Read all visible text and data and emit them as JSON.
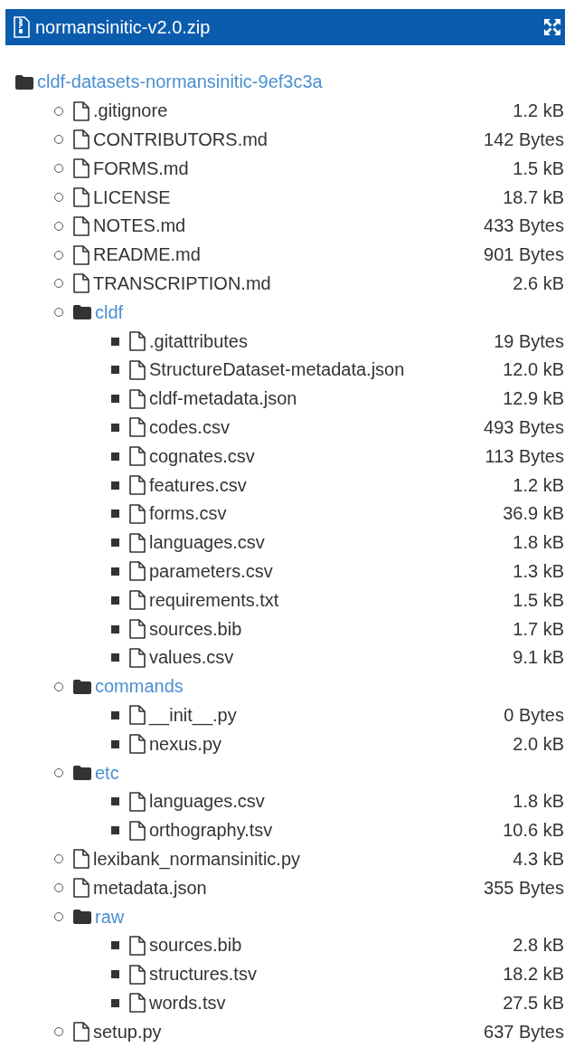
{
  "header": {
    "title": "normansinitic-v2.0.zip"
  },
  "tree": [
    {
      "kind": "folder",
      "name": "cldf-datasets-normansinitic-9ef3c3a",
      "children": [
        {
          "kind": "file",
          "name": ".gitignore",
          "size": "1.2 kB"
        },
        {
          "kind": "file",
          "name": "CONTRIBUTORS.md",
          "size": "142 Bytes"
        },
        {
          "kind": "file",
          "name": "FORMS.md",
          "size": "1.5 kB"
        },
        {
          "kind": "file",
          "name": "LICENSE",
          "size": "18.7 kB"
        },
        {
          "kind": "file",
          "name": "NOTES.md",
          "size": "433 Bytes"
        },
        {
          "kind": "file",
          "name": "README.md",
          "size": "901 Bytes"
        },
        {
          "kind": "file",
          "name": "TRANSCRIPTION.md",
          "size": "2.6 kB"
        },
        {
          "kind": "folder",
          "name": "cldf",
          "children": [
            {
              "kind": "file",
              "name": ".gitattributes",
              "size": "19 Bytes"
            },
            {
              "kind": "file",
              "name": "StructureDataset-metadata.json",
              "size": "12.0 kB"
            },
            {
              "kind": "file",
              "name": "cldf-metadata.json",
              "size": "12.9 kB"
            },
            {
              "kind": "file",
              "name": "codes.csv",
              "size": "493 Bytes"
            },
            {
              "kind": "file",
              "name": "cognates.csv",
              "size": "113 Bytes"
            },
            {
              "kind": "file",
              "name": "features.csv",
              "size": "1.2 kB"
            },
            {
              "kind": "file",
              "name": "forms.csv",
              "size": "36.9 kB"
            },
            {
              "kind": "file",
              "name": "languages.csv",
              "size": "1.8 kB"
            },
            {
              "kind": "file",
              "name": "parameters.csv",
              "size": "1.3 kB"
            },
            {
              "kind": "file",
              "name": "requirements.txt",
              "size": "1.5 kB"
            },
            {
              "kind": "file",
              "name": "sources.bib",
              "size": "1.7 kB"
            },
            {
              "kind": "file",
              "name": "values.csv",
              "size": "9.1 kB"
            }
          ]
        },
        {
          "kind": "folder",
          "name": "commands",
          "children": [
            {
              "kind": "file",
              "name": "__init__.py",
              "size": "0 Bytes"
            },
            {
              "kind": "file",
              "name": "nexus.py",
              "size": "2.0 kB"
            }
          ]
        },
        {
          "kind": "folder",
          "name": "etc",
          "children": [
            {
              "kind": "file",
              "name": "languages.csv",
              "size": "1.8 kB"
            },
            {
              "kind": "file",
              "name": "orthography.tsv",
              "size": "10.6 kB"
            }
          ]
        },
        {
          "kind": "file",
          "name": "lexibank_normansinitic.py",
          "size": "4.3 kB"
        },
        {
          "kind": "file",
          "name": "metadata.json",
          "size": "355 Bytes"
        },
        {
          "kind": "folder",
          "name": "raw",
          "children": [
            {
              "kind": "file",
              "name": "sources.bib",
              "size": "2.8 kB"
            },
            {
              "kind": "file",
              "name": "structures.tsv",
              "size": "18.2 kB"
            },
            {
              "kind": "file",
              "name": "words.tsv",
              "size": "27.5 kB"
            }
          ]
        },
        {
          "kind": "file",
          "name": "setup.py",
          "size": "637 Bytes"
        }
      ]
    }
  ]
}
